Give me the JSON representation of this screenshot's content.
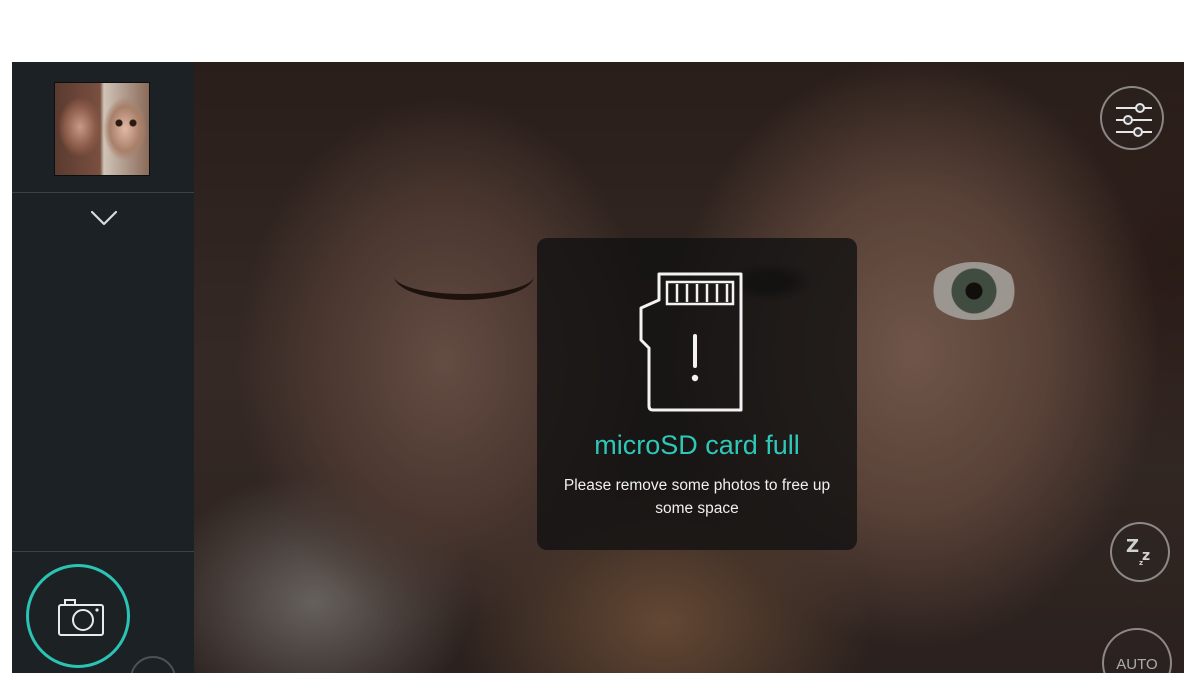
{
  "dialog": {
    "title": "microSD card full",
    "message": "Please remove some photos to free up some space",
    "icon": "microsd-card-alert-icon",
    "accent_color": "#2ec8b8"
  },
  "sidebar": {
    "thumbnail": "last-photo-thumbnail",
    "expand_icon": "chevron-down-icon",
    "shutter_icon": "camera-icon",
    "shutter_color": "#2bc4b4"
  },
  "controls": {
    "settings_icon": "sliders-icon",
    "sleep_icon": "sleep-zzz-icon",
    "sleep_label_big": "Z",
    "sleep_label_small": "z",
    "sleep_label_tiny": "z",
    "auto_label": "AUTO"
  }
}
